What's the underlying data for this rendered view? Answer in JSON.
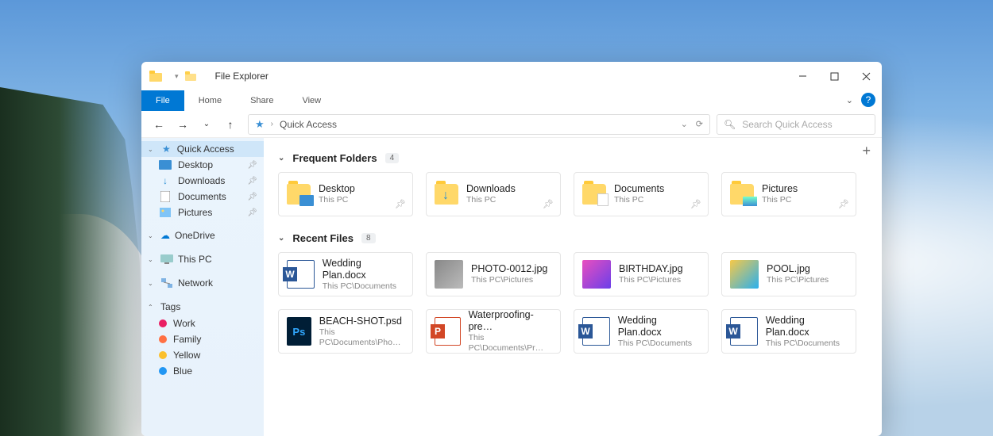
{
  "window": {
    "title": "File Explorer"
  },
  "ribbonTabs": {
    "file": "File",
    "home": "Home",
    "share": "Share",
    "view": "View"
  },
  "help": {
    "label": "?"
  },
  "address": {
    "path": "Quick Access"
  },
  "search": {
    "placeholder": "Search Quick Access"
  },
  "sidebar": {
    "quickAccess": {
      "label": "Quick Access",
      "items": [
        {
          "label": "Desktop"
        },
        {
          "label": "Downloads"
        },
        {
          "label": "Documents"
        },
        {
          "label": "Pictures"
        }
      ]
    },
    "onedrive": {
      "label": "OneDrive"
    },
    "thispc": {
      "label": "This PC"
    },
    "network": {
      "label": "Network"
    },
    "tags": {
      "label": "Tags",
      "items": [
        {
          "label": "Work",
          "color": "#e91e63"
        },
        {
          "label": "Family",
          "color": "#ff7043"
        },
        {
          "label": "Yellow",
          "color": "#fbc02d"
        },
        {
          "label": "Blue",
          "color": "#2196f3"
        }
      ]
    }
  },
  "sections": {
    "frequent": {
      "title": "Frequent Folders",
      "count": "4"
    },
    "recent": {
      "title": "Recent Files",
      "count": "8"
    }
  },
  "frequent": [
    {
      "name": "Desktop",
      "sub": "This PC",
      "kind": "desktop"
    },
    {
      "name": "Downloads",
      "sub": "This PC",
      "kind": "downloads"
    },
    {
      "name": "Documents",
      "sub": "This PC",
      "kind": "docs"
    },
    {
      "name": "Pictures",
      "sub": "This PC",
      "kind": "pics"
    }
  ],
  "recent": [
    {
      "name": "Wedding Plan.docx",
      "sub": "This PC\\Documents",
      "icon": "word"
    },
    {
      "name": "PHOTO-0012.jpg",
      "sub": "This PC\\Pictures",
      "icon": "photo"
    },
    {
      "name": "BIRTHDAY.jpg",
      "sub": "This PC\\Pictures",
      "icon": "photo b"
    },
    {
      "name": "POOL.jpg",
      "sub": "This PC\\Pictures",
      "icon": "photo c"
    },
    {
      "name": "BEACH-SHOT.psd",
      "sub": "This PC\\Documents\\Pho…",
      "icon": "ps",
      "txt": "Ps"
    },
    {
      "name": "Waterproofing-pre…",
      "sub": "This PC\\Documents\\Pr…",
      "icon": "ppt"
    },
    {
      "name": "Wedding Plan.docx",
      "sub": "This PC\\Documents",
      "icon": "word"
    },
    {
      "name": "Wedding Plan.docx",
      "sub": "This PC\\Documents",
      "icon": "word"
    }
  ]
}
